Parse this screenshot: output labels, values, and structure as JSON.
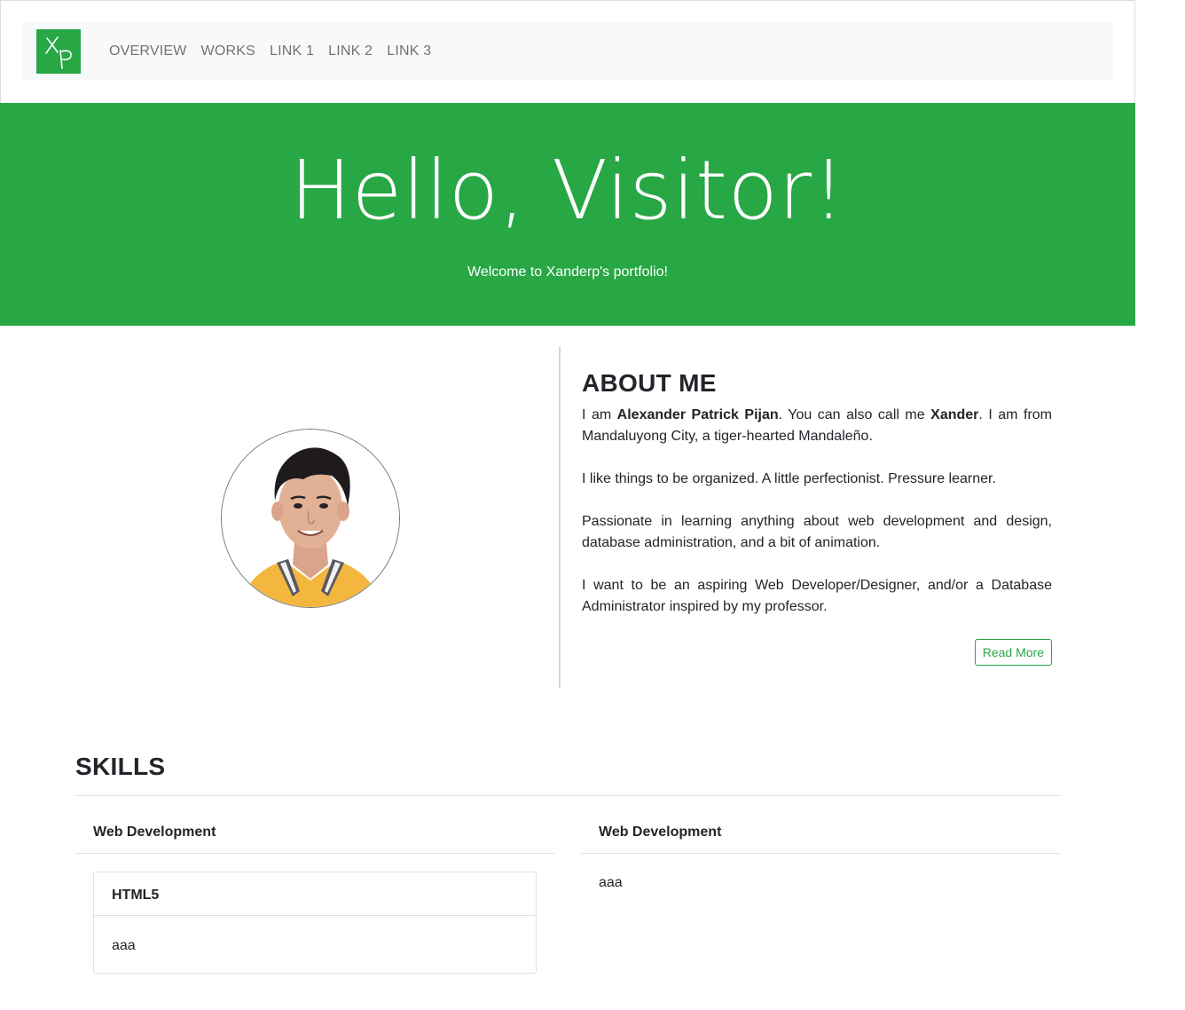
{
  "nav": {
    "brand_initials": "XP",
    "links": [
      "OVERVIEW",
      "WORKS",
      "LINK 1",
      "LINK 2",
      "LINK 3"
    ]
  },
  "hero": {
    "title": "Hello, Visitor!",
    "subtitle": "Welcome to Xanderp's portfolio!"
  },
  "about": {
    "title": "ABOUT ME",
    "intro_prefix": "I am ",
    "full_name": "Alexander Patrick Pijan",
    "intro_middle": ". You can also call me ",
    "nickname": "Xander",
    "intro_suffix": ". I am from Mandaluyong City, a tiger-hearted Mandaleño.",
    "p2": "I like things to be organized. A little perfectionist. Pressure learner.",
    "p3": "Passionate in learning anything about web development and design, database administration, and a bit of animation.",
    "p4": "I want to be an aspiring Web Developer/Designer, and/or a Database Administrator inspired by my professor.",
    "read_more": "Read More"
  },
  "skills": {
    "title": "SKILLS",
    "col1": {
      "heading": "Web Development",
      "card": {
        "heading": "HTML5",
        "body": "aaa"
      }
    },
    "col2": {
      "heading": "Web Development",
      "body": "aaa"
    }
  },
  "colors": {
    "accent": "#28a745",
    "nav_bg": "#f8f9fa",
    "text": "#212529"
  }
}
